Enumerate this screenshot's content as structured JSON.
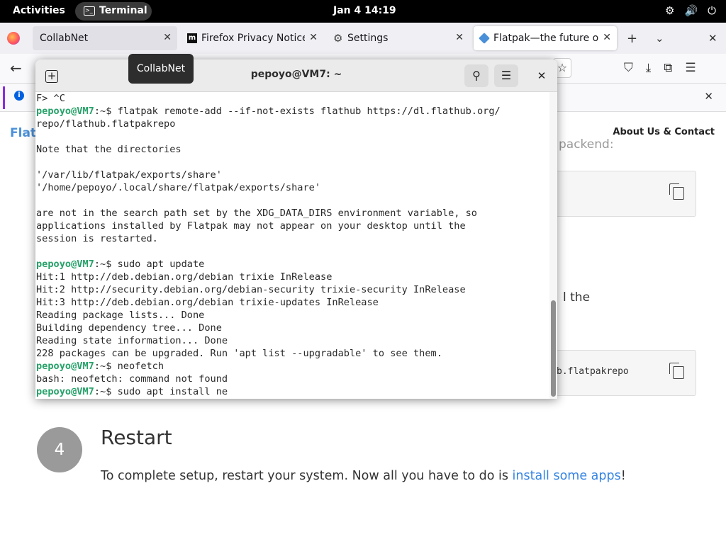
{
  "topbar": {
    "activities": "Activities",
    "app_name": "Terminal",
    "clock": "Jan 4  14:19",
    "tray_icons": [
      "accessibility-icon",
      "volume-icon",
      "power-icon"
    ]
  },
  "browser": {
    "tabs": [
      {
        "label": "CollabNet",
        "state": "hover"
      },
      {
        "label": "Firefox Privacy Notice —",
        "state": "inactive"
      },
      {
        "label": "Settings",
        "state": "inactive"
      },
      {
        "label": "Flatpak—the future of",
        "state": "active"
      }
    ],
    "tooltip": "CollabNet"
  },
  "page": {
    "brand": "Flat",
    "about": "About Us & Contact",
    "fragment_backend": "packend:",
    "fragment_the": "l the",
    "code_fragment": "b.flatpakrepo",
    "step_number": "4",
    "step_title": "Restart",
    "step_desc_prefix": "To complete setup, restart your system. Now all you have to do is ",
    "step_desc_link": "install some apps",
    "step_desc_suffix": "!"
  },
  "terminal": {
    "title": "pepoyo@VM7: ~",
    "lines": [
      {
        "prompt": "",
        "text": "F> ^C"
      },
      {
        "prompt": "pepoyo@VM7",
        "text": ":~$ flatpak remote-add --if-not-exists flathub https://dl.flathub.org/"
      },
      {
        "prompt": "",
        "text": "repo/flathub.flatpakrepo"
      },
      {
        "prompt": "",
        "text": ""
      },
      {
        "prompt": "",
        "text": "Note that the directories"
      },
      {
        "prompt": "",
        "text": ""
      },
      {
        "prompt": "",
        "text": "'/var/lib/flatpak/exports/share'"
      },
      {
        "prompt": "",
        "text": "'/home/pepoyo/.local/share/flatpak/exports/share'"
      },
      {
        "prompt": "",
        "text": ""
      },
      {
        "prompt": "",
        "text": "are not in the search path set by the XDG_DATA_DIRS environment variable, so"
      },
      {
        "prompt": "",
        "text": "applications installed by Flatpak may not appear on your desktop until the"
      },
      {
        "prompt": "",
        "text": "session is restarted."
      },
      {
        "prompt": "",
        "text": ""
      },
      {
        "prompt": "pepoyo@VM7",
        "text": ":~$ sudo apt update"
      },
      {
        "prompt": "",
        "text": "Hit:1 http://deb.debian.org/debian trixie InRelease"
      },
      {
        "prompt": "",
        "text": "Hit:2 http://security.debian.org/debian-security trixie-security InRelease"
      },
      {
        "prompt": "",
        "text": "Hit:3 http://deb.debian.org/debian trixie-updates InRelease"
      },
      {
        "prompt": "",
        "text": "Reading package lists... Done"
      },
      {
        "prompt": "",
        "text": "Building dependency tree... Done"
      },
      {
        "prompt": "",
        "text": "Reading state information... Done"
      },
      {
        "prompt": "",
        "text": "228 packages can be upgraded. Run 'apt list --upgradable' to see them."
      },
      {
        "prompt": "pepoyo@VM7",
        "text": ":~$ neofetch"
      },
      {
        "prompt": "",
        "text": "bash: neofetch: command not found"
      },
      {
        "prompt": "pepoyo@VM7",
        "text": ":~$ sudo apt install ne"
      }
    ]
  },
  "colors": {
    "prompt_green": "#26a269",
    "link_blue": "#3584e4",
    "topbar_bg": "#000000"
  }
}
